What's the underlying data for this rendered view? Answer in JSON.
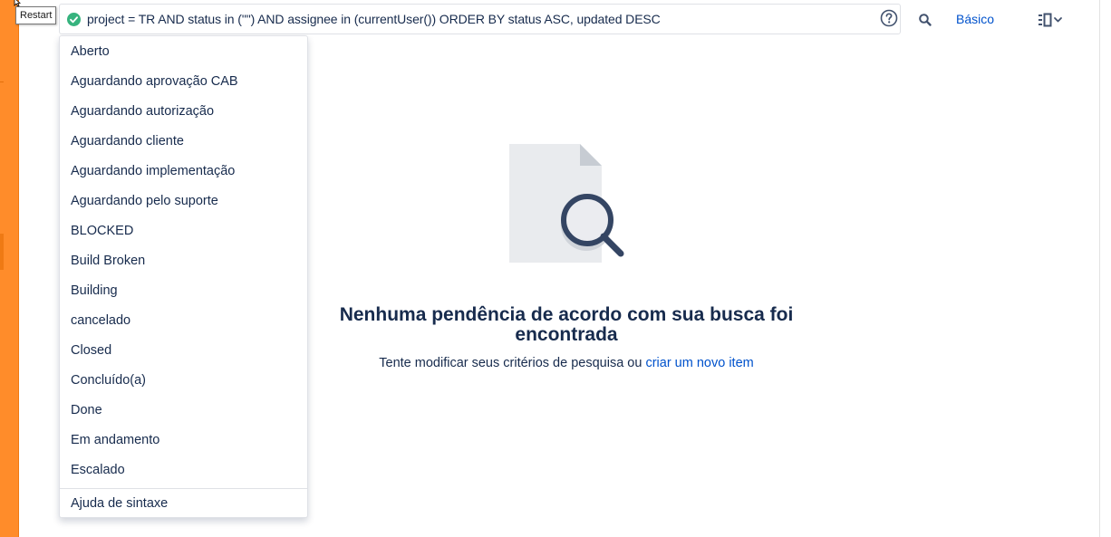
{
  "tooltip": {
    "text": "Restart"
  },
  "query": {
    "text": "project = TR AND status in (\"\") AND assignee in (currentUser()) ORDER BY status ASC, updated DESC",
    "valid_icon": "check-circle-icon",
    "help_icon": "question-circle-icon"
  },
  "toolbar": {
    "search_icon": "search-icon",
    "basic_label": "Básico",
    "layout_icon": "list-layout-icon"
  },
  "dropdown": {
    "items": [
      "Aberto",
      "Aguardando aprovação CAB",
      "Aguardando autorização",
      "Aguardando cliente",
      "Aguardando implementação",
      "Aguardando pelo suporte",
      "BLOCKED",
      "Build Broken",
      "Building",
      "cancelado",
      "Closed",
      "Concluído(a)",
      "Done",
      "Em andamento",
      "Escalado"
    ],
    "syntax_help": "Ajuda de sintaxe"
  },
  "empty_state": {
    "title": "Nenhuma pendência de acordo com sua busca foi encontrada",
    "description": "Tente modificar seus critérios de pesquisa ou",
    "link": "criar um novo item"
  },
  "colors": {
    "accent_orange": "#ff8c2a",
    "link_blue": "#0052cc",
    "success_green": "#36b37e",
    "text_dark": "#172b4d"
  }
}
